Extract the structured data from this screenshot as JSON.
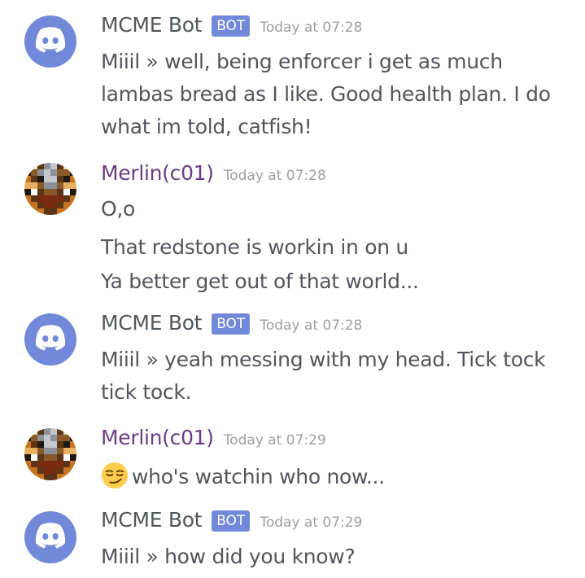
{
  "colors": {
    "bot_badge": "#7289da",
    "merlin_name": "#6a3c86",
    "timestamp": "#99a0a8",
    "text": "#4f5660"
  },
  "messages": [
    {
      "author": "MCME Bot",
      "badge": "BOT",
      "timestamp": "Today at 07:28",
      "avatar": "discord-logo-icon",
      "lines": [
        "Miiil »  well, being enforcer i get as much",
        "lambas bread as I like. Good health plan. I do",
        "what im told, catfish!"
      ]
    },
    {
      "author": "Merlin(c01)",
      "timestamp": "Today at 07:28",
      "avatar": "minecraft-head-icon",
      "lines": [
        "O,o",
        "That redstone is workin in on u",
        "Ya better get out of that world..."
      ]
    },
    {
      "author": "MCME Bot",
      "badge": "BOT",
      "timestamp": "Today at 07:28",
      "avatar": "discord-logo-icon",
      "lines": [
        "Miiil »  yeah messing with my head. Tick tock",
        "tick tock."
      ]
    },
    {
      "author": "Merlin(c01)",
      "timestamp": "Today at 07:29",
      "avatar": "minecraft-head-icon",
      "emoji": "smirking-face-icon",
      "lines": [
        "who's watchin who now..."
      ]
    },
    {
      "author": "MCME Bot",
      "badge": "BOT",
      "timestamp": "Today at 07:29",
      "avatar": "discord-logo-icon",
      "lines": [
        "Miiil »  how did you know?"
      ]
    }
  ]
}
